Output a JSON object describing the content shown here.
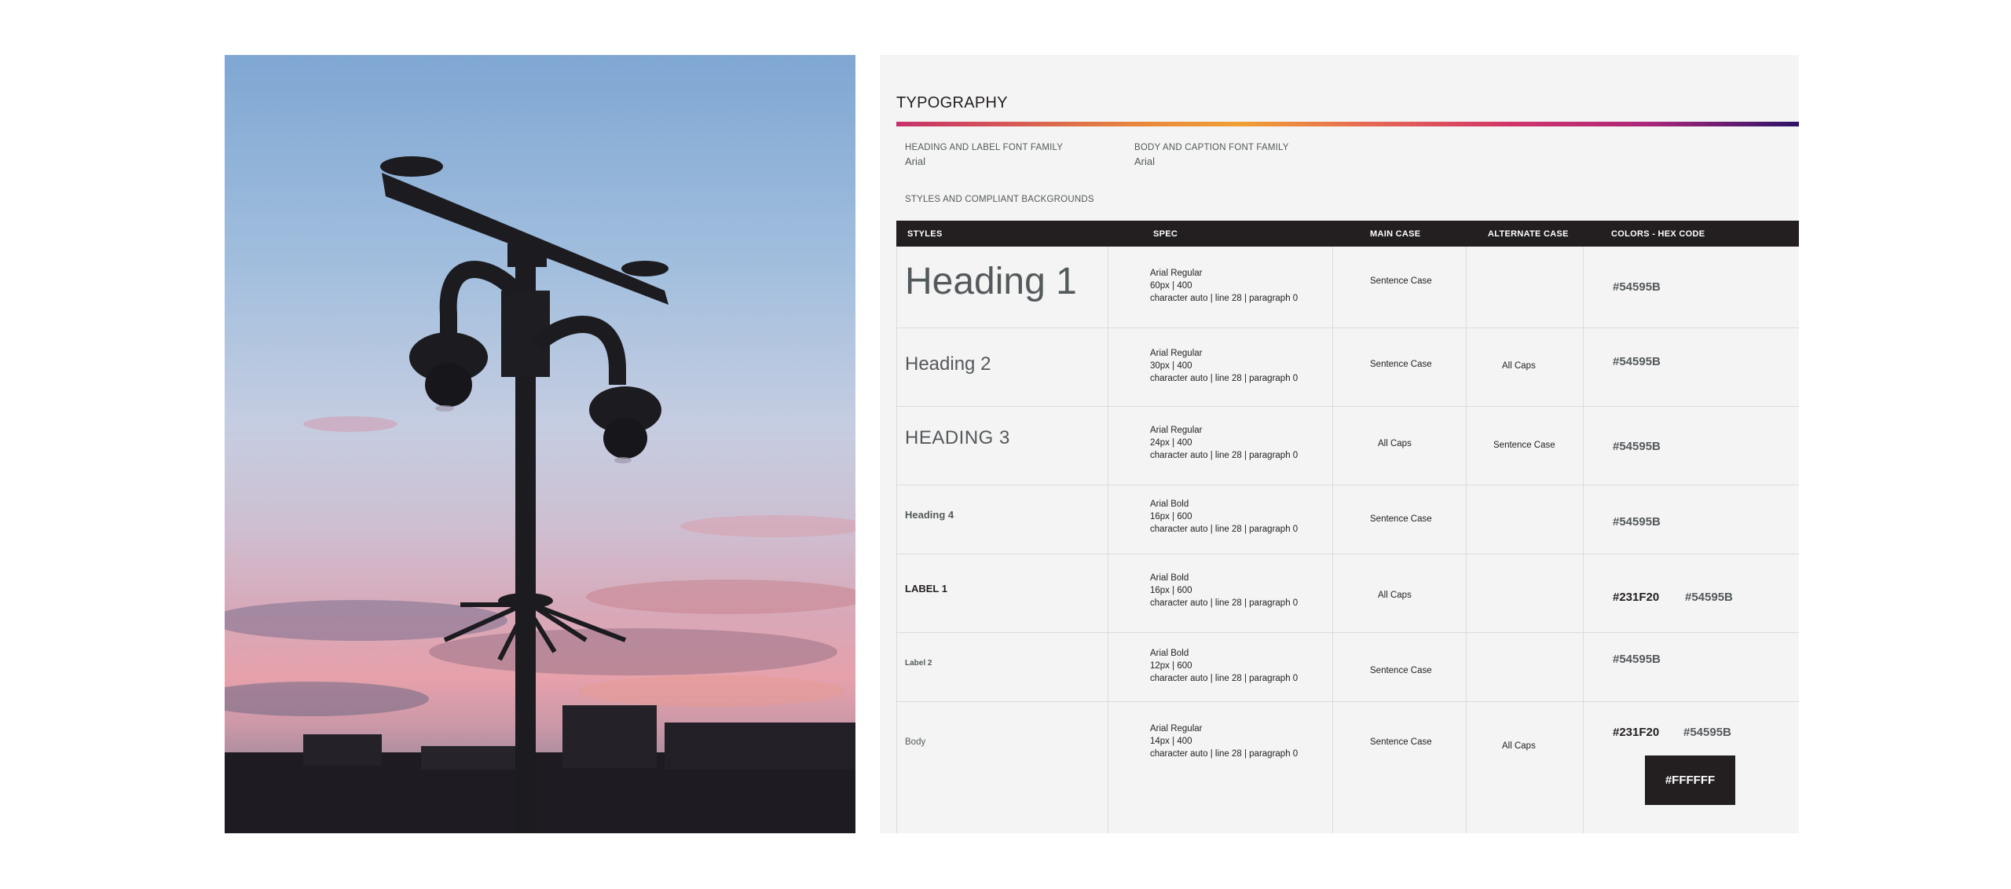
{
  "photo": {
    "alt_icon": "security-camera-pole-silhouette"
  },
  "typography": {
    "title": "TYPOGRAPHY",
    "heading_font_label": "HEADING AND LABEL FONT FAMILY",
    "heading_font_value": "Arial",
    "body_font_label": "BODY AND CAPTION FONT FAMILY",
    "body_font_value": "Arial",
    "section_label": "STYLES AND COMPLIANT BACKGROUNDS",
    "columns": [
      "STYLES",
      "SPEC",
      "MAIN CASE",
      "ALTERNATE CASE",
      "COLORS - HEX CODE"
    ],
    "rows": [
      {
        "style": "Heading 1",
        "spec": [
          "Arial Regular",
          "60px | 400",
          "character auto | line 28 | paragraph 0"
        ],
        "main_case": "Sentence Case",
        "alt_case": "",
        "colors": [
          "#54595B"
        ]
      },
      {
        "style": "Heading 2",
        "spec": [
          "Arial Regular",
          "30px | 400",
          "character auto | line 28 | paragraph 0"
        ],
        "main_case": "Sentence Case",
        "alt_case": "All Caps",
        "colors": [
          "#54595B"
        ]
      },
      {
        "style": "HEADING 3",
        "spec": [
          "Arial Regular",
          "24px | 400",
          "character auto | line 28 | paragraph 0"
        ],
        "main_case": "All Caps",
        "alt_case": "Sentence Case",
        "colors": [
          "#54595B"
        ]
      },
      {
        "style": "Heading 4",
        "spec": [
          "Arial Bold",
          "16px | 600",
          "character auto | line 28 | paragraph 0"
        ],
        "main_case": "Sentence Case",
        "alt_case": "",
        "colors": [
          "#54595B"
        ]
      },
      {
        "style": "LABEL 1",
        "spec": [
          "Arial Bold",
          "16px | 600",
          "character auto | line 28 | paragraph 0"
        ],
        "main_case": "All Caps",
        "alt_case": "",
        "colors": [
          "#231F20",
          "#54595B"
        ]
      },
      {
        "style": "Label 2",
        "spec": [
          "Arial Bold",
          "12px | 600",
          "character auto | line 28 | paragraph 0"
        ],
        "main_case": "Sentence Case",
        "alt_case": "",
        "colors": [
          "#54595B"
        ]
      },
      {
        "style": "Body",
        "spec": [
          "Arial Regular",
          "14px | 400",
          "character auto | line 28 | paragraph 0"
        ],
        "main_case": "Sentence Case",
        "alt_case": "All Caps",
        "colors": [
          "#231F20",
          "#54595B"
        ],
        "swatch": "#FFFFFF"
      }
    ]
  },
  "palette": {
    "dark": "#231F20",
    "gray": "#54595B",
    "panel_bg": "#f4f4f4"
  }
}
